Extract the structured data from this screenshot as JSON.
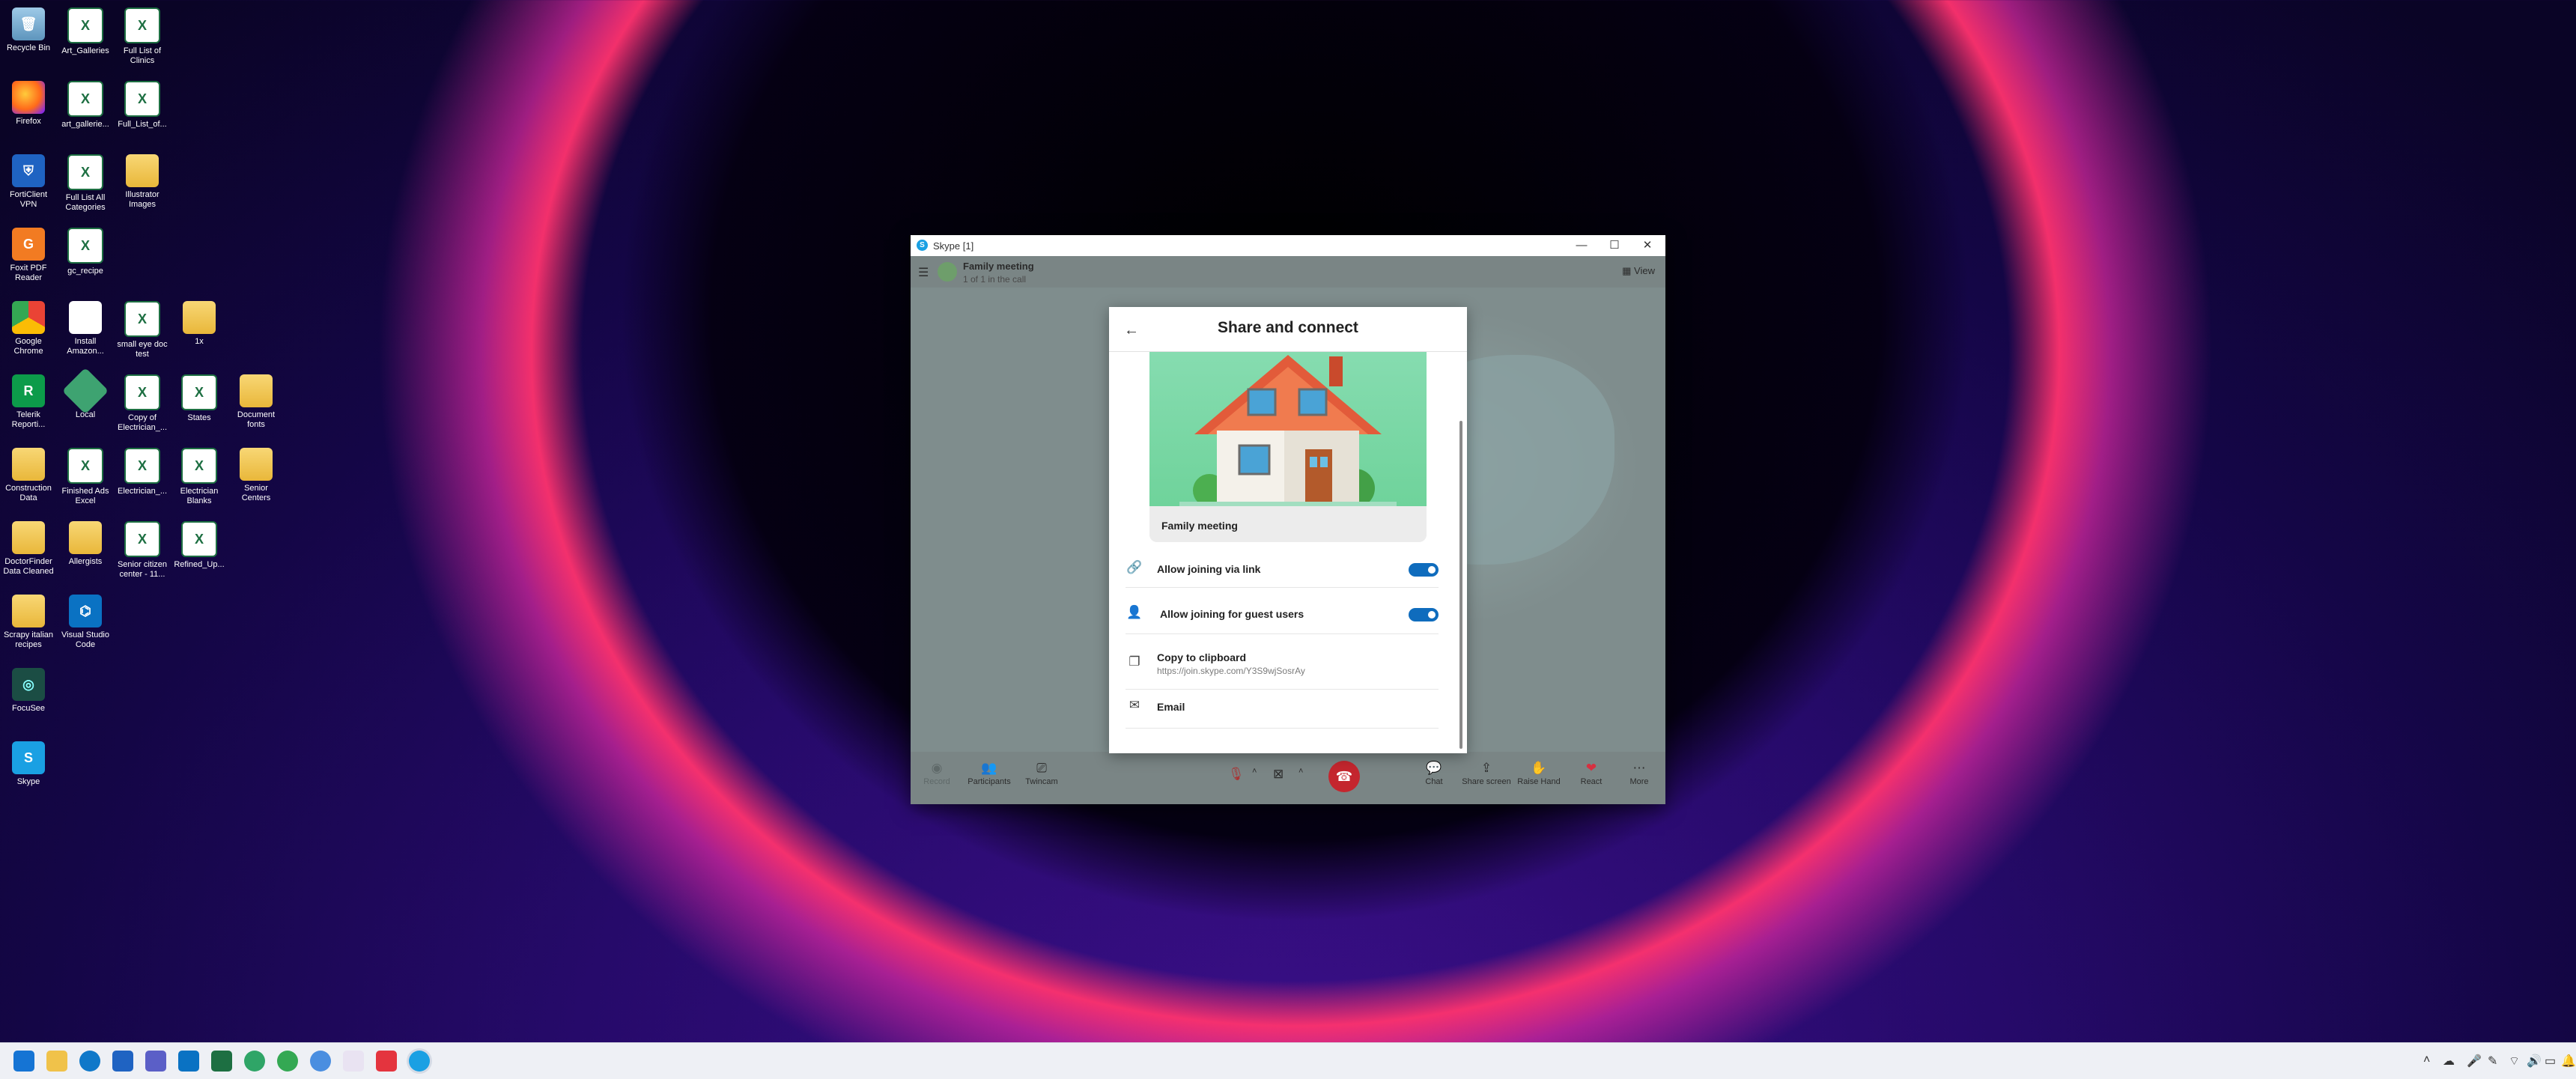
{
  "desktop": {
    "icons": [
      {
        "label": "Recycle Bin"
      },
      {
        "label": "Art_Galleries"
      },
      {
        "label": "Full List of Clinics"
      },
      {
        "label": "Firefox"
      },
      {
        "label": "art_gallerie..."
      },
      {
        "label": "Full_List_of..."
      },
      {
        "label": "FortiClient VPN"
      },
      {
        "label": "Full List All Categories"
      },
      {
        "label": "Illustrator Images"
      },
      {
        "label": "Foxit PDF Reader"
      },
      {
        "label": "gc_recipe"
      },
      {
        "label": "Google Chrome"
      },
      {
        "label": "Install Amazon..."
      },
      {
        "label": "small eye doc test"
      },
      {
        "label": "1x"
      },
      {
        "label": "Telerik Reporti..."
      },
      {
        "label": "Local"
      },
      {
        "label": "Copy of Electrician_..."
      },
      {
        "label": "States"
      },
      {
        "label": "Document fonts"
      },
      {
        "label": "Construction Data"
      },
      {
        "label": "Finished Ads Excel"
      },
      {
        "label": "Electrician_..."
      },
      {
        "label": "Electrician Blanks"
      },
      {
        "label": "Senior Centers"
      },
      {
        "label": "DoctorFinder Data Cleaned"
      },
      {
        "label": "Allergists"
      },
      {
        "label": "Senior citizen center - 11..."
      },
      {
        "label": "Refined_Up..."
      },
      {
        "label": "Scrapy italian recipes"
      },
      {
        "label": "Visual Studio Code"
      },
      {
        "label": "FocuSee"
      },
      {
        "label": "Skype"
      }
    ]
  },
  "window": {
    "title": "Skype [1]",
    "minimize": "—",
    "maximize": "☐",
    "close": "✕"
  },
  "call": {
    "name": "Family meeting",
    "subtitle": "1 of 1 in the call",
    "view_label": "View",
    "buttons": {
      "record": "Record",
      "participants": "Participants",
      "twincam": "Twincam",
      "chat": "Chat",
      "share_screen": "Share screen",
      "raise_hand": "Raise Hand",
      "react": "React",
      "more": "More"
    }
  },
  "modal": {
    "title": "Share and connect",
    "hero_label": "Family meeting",
    "rows": {
      "link": "Allow joining via link",
      "guest": "Allow joining for guest users",
      "clipboard": "Copy to clipboard",
      "clipboard_url": "https://join.skype.com/Y3S9wjSosrAy",
      "email": "Email"
    },
    "toggles": {
      "link": true,
      "guest": true
    }
  },
  "colors": {
    "accent": "#0f6cbd",
    "hangup": "#c4262e"
  }
}
